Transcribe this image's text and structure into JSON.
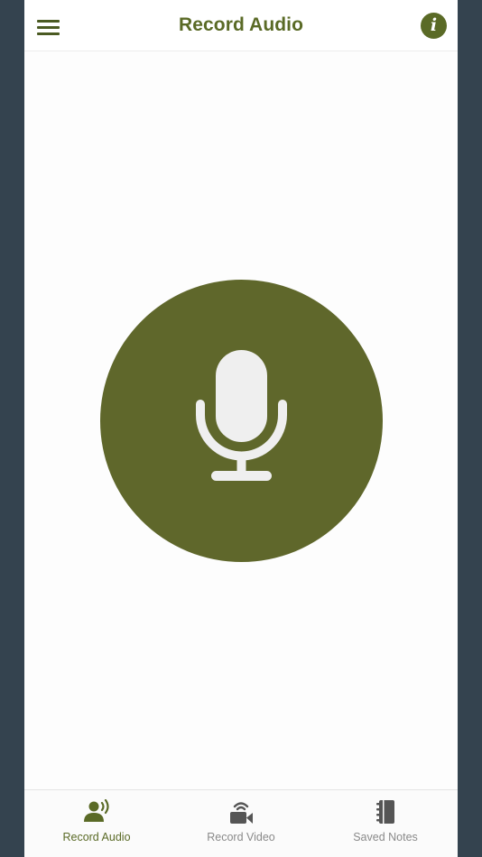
{
  "header": {
    "title": "Record Audio",
    "menu_icon": "hamburger-menu-icon",
    "info_icon": "info-icon",
    "info_glyph": "i"
  },
  "main": {
    "record_button_icon": "microphone-icon"
  },
  "tabs": [
    {
      "label": "Record Audio",
      "icon": "person-speaking-icon",
      "active": true
    },
    {
      "label": "Record Video",
      "icon": "video-camera-icon",
      "active": false
    },
    {
      "label": "Saved Notes",
      "icon": "notebook-icon",
      "active": false
    }
  ],
  "colors": {
    "accent": "#5f672b",
    "title": "#5a6a26",
    "side_background": "#34434f",
    "tab_inactive": "#8a8a8a",
    "icon_inactive": "#555555",
    "mic_fill": "#efefef"
  }
}
